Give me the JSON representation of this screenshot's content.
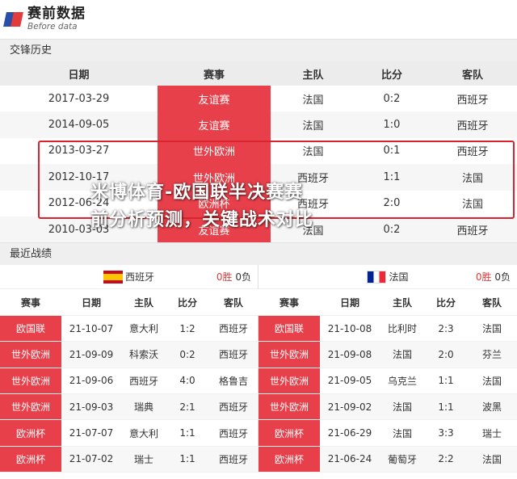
{
  "brand": {
    "name_cn": "赛前数据",
    "name_en": "Before data"
  },
  "h2h": {
    "title": "交锋历史",
    "headers": [
      "日期",
      "赛事",
      "主队",
      "比分",
      "客队"
    ],
    "rows": [
      [
        "2017-03-29",
        "友谊赛",
        "法国",
        "0:2",
        "西班牙"
      ],
      [
        "2014-09-05",
        "友谊赛",
        "法国",
        "1:0",
        "西班牙"
      ],
      [
        "2013-03-27",
        "世外欧洲",
        "法国",
        "0:1",
        "西班牙"
      ],
      [
        "2012-10-17",
        "世外欧洲",
        "西班牙",
        "1:1",
        "法国"
      ],
      [
        "2012-06-24",
        "欧洲杯",
        "西班牙",
        "2:0",
        "法国"
      ],
      [
        "2010-03-03",
        "友谊赛",
        "法国",
        "0:2",
        "西班牙"
      ]
    ]
  },
  "watermark": {
    "line1": "米博体育-欧国联半决赛赛",
    "line2": "前分析预测，关键战术对比"
  },
  "recent": {
    "title": "最近战绩",
    "headers": [
      "赛事",
      "日期",
      "主队",
      "比分",
      "客队"
    ],
    "teams": [
      {
        "name": "西班牙",
        "wins": "0胜",
        "losses": "0负",
        "rows": [
          [
            "欧国联",
            "21-10-07",
            "意大利",
            "1:2",
            "西班牙"
          ],
          [
            "世外欧洲",
            "21-09-09",
            "科索沃",
            "0:2",
            "西班牙"
          ],
          [
            "世外欧洲",
            "21-09-06",
            "西班牙",
            "4:0",
            "格鲁吉"
          ],
          [
            "世外欧洲",
            "21-09-03",
            "瑞典",
            "2:1",
            "西班牙"
          ],
          [
            "欧洲杯",
            "21-07-07",
            "意大利",
            "1:1",
            "西班牙"
          ],
          [
            "欧洲杯",
            "21-07-02",
            "瑞士",
            "1:1",
            "西班牙"
          ]
        ]
      },
      {
        "name": "法国",
        "wins": "0胜",
        "losses": "0负",
        "rows": [
          [
            "欧国联",
            "21-10-08",
            "比利时",
            "2:3",
            "法国"
          ],
          [
            "世外欧洲",
            "21-09-08",
            "法国",
            "2:0",
            "芬兰"
          ],
          [
            "世外欧洲",
            "21-09-05",
            "乌克兰",
            "1:1",
            "法国"
          ],
          [
            "世外欧洲",
            "21-09-02",
            "法国",
            "1:1",
            "波黑"
          ],
          [
            "欧洲杯",
            "21-06-29",
            "法国",
            "3:3",
            "瑞士"
          ],
          [
            "欧洲杯",
            "21-06-24",
            "葡萄牙",
            "2:2",
            "法国"
          ]
        ]
      }
    ]
  },
  "colors": {
    "accent_red": "#e8404a",
    "highlight_border": "#d9232e",
    "brand_blue": "#2a4fa8"
  }
}
